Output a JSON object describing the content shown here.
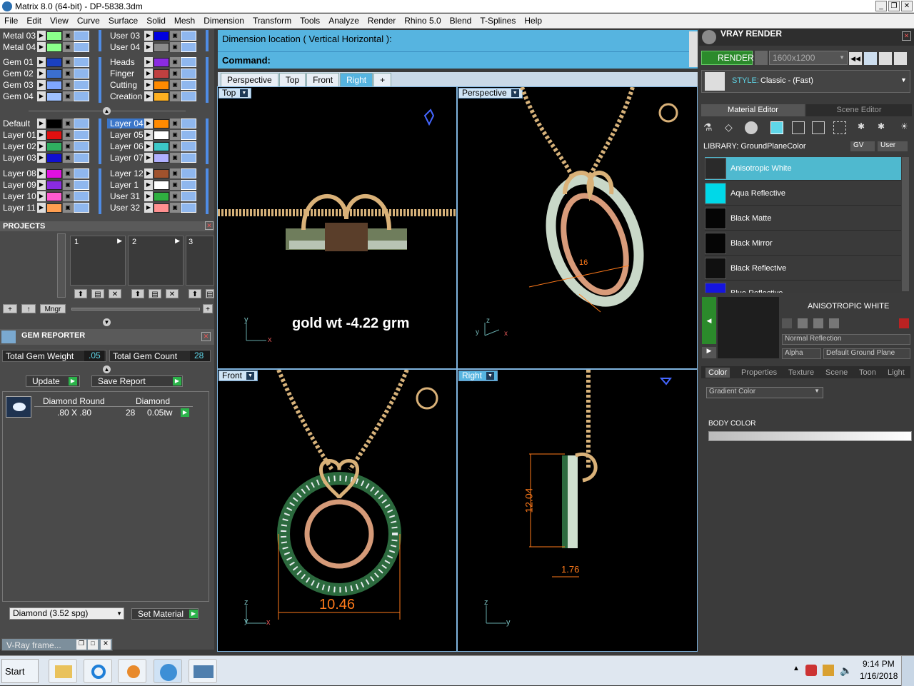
{
  "window": {
    "title": "Matrix 8.0 (64-bit) - DP-5838.3dm"
  },
  "menu": [
    "File",
    "Edit",
    "View",
    "Curve",
    "Surface",
    "Solid",
    "Mesh",
    "Dimension",
    "Transform",
    "Tools",
    "Analyze",
    "Render",
    "Rhino 5.0",
    "Blend",
    "T-Splines",
    "Help"
  ],
  "layers": {
    "col1": [
      {
        "name": "Metal 03",
        "color": "#8bff8b"
      },
      {
        "name": "Metal 04",
        "color": "#8bff8b"
      },
      {
        "name": "Gem 01",
        "color": "#1a40c0"
      },
      {
        "name": "Gem 02",
        "color": "#3b6fd0"
      },
      {
        "name": "Gem 03",
        "color": "#7fa7ff"
      },
      {
        "name": "Gem 04",
        "color": "#9ec0ff"
      },
      {
        "name": "Default",
        "color": "#000000"
      },
      {
        "name": "Layer 01",
        "color": "#e01010"
      },
      {
        "name": "Layer 02",
        "color": "#2fb060"
      },
      {
        "name": "Layer 03",
        "color": "#1010d0"
      },
      {
        "name": "Layer 08",
        "color": "#e010e0"
      },
      {
        "name": "Layer 09",
        "color": "#8a2be2"
      },
      {
        "name": "Layer 10",
        "color": "#ff5ad0"
      },
      {
        "name": "Layer 11",
        "color": "#ff9e50"
      }
    ],
    "col2": [
      {
        "name": "User 03",
        "color": "#0000e0"
      },
      {
        "name": "User 04",
        "color": "#8a8a8a"
      },
      {
        "name": "Heads",
        "color": "#8a2be2"
      },
      {
        "name": "Finger",
        "color": "#c04040"
      },
      {
        "name": "Cutting",
        "color": "#ff8a00"
      },
      {
        "name": "Creation",
        "color": "#ffb020"
      },
      {
        "name": "Layer 04",
        "color": "#ff8a00"
      },
      {
        "name": "Layer 05",
        "color": "#ffffff"
      },
      {
        "name": "Layer 06",
        "color": "#3cc8c8"
      },
      {
        "name": "Layer 07",
        "color": "#b0b0ff"
      },
      {
        "name": "Layer 12",
        "color": "#a0522d"
      },
      {
        "name": "Layer 1",
        "color": "#ffffff"
      },
      {
        "name": "User 31",
        "color": "#2fb040"
      },
      {
        "name": "User 32",
        "color": "#ff9090"
      }
    ]
  },
  "projects": {
    "title": "PROJECTS",
    "slots": [
      "1",
      "2",
      "3"
    ],
    "add": "+",
    "up": "↑",
    "mngr": "Mngr"
  },
  "gem_reporter": {
    "title": "GEM REPORTER",
    "weight_label": "Total Gem Weight",
    "weight_value": ".05",
    "count_label": "Total Gem Count",
    "count_value": "28",
    "update": "Update",
    "save": "Save Report",
    "cols": [
      "Diamond Round",
      "Diamond"
    ],
    "row": {
      "size": ".80 X .80",
      "count": "28",
      "tw": "0.05tw"
    },
    "material": "Diamond    (3.52 spg)",
    "set_material": "Set Material"
  },
  "vray_frame": "V-Ray frame...",
  "command": {
    "prompt1": "Dimension location ( Vertical  Horizontal ):",
    "prompt2": "Command:"
  },
  "view_tabs": [
    "Perspective",
    "Top",
    "Front",
    "Right",
    "+"
  ],
  "viewports": {
    "top": {
      "label": "Top",
      "overlay": "gold wt -4.22 grm"
    },
    "persp": {
      "label": "Perspective",
      "dim": "16"
    },
    "front": {
      "label": "Front",
      "dim": "10.46"
    },
    "right": {
      "label": "Right",
      "dim_v": "12.04",
      "dim_h": "1.76"
    }
  },
  "axes": {
    "x": "x",
    "y": "y",
    "z": "z"
  },
  "vray": {
    "title": "VRAY RENDER",
    "render": "RENDER",
    "resolution": "1600x1200",
    "style_label": "STYLE:",
    "style_value": "Classic - (Fast)",
    "tabs": [
      "Material Editor",
      "Scene Editor"
    ],
    "library": "LIBRARY: GroundPlaneColor",
    "gv": "GV",
    "user": "User",
    "materials": [
      {
        "name": "Anisotropic White",
        "color": "#2a2a2a"
      },
      {
        "name": "Aqua Reflective",
        "color": "#00d8e8"
      },
      {
        "name": "Black Matte",
        "color": "#050505"
      },
      {
        "name": "Black Mirror",
        "color": "#050505"
      },
      {
        "name": "Black Reflective",
        "color": "#101010"
      },
      {
        "name": "Blue Reflective",
        "color": "#1515e0"
      }
    ],
    "selected": "ANISOTROPIC WHITE",
    "reflection": "Normal Reflection",
    "alpha": "Alpha",
    "ground": "Default Ground Plane",
    "prop_tabs": [
      "Color",
      "Properties",
      "Texture",
      "Scene",
      "Toon",
      "Light"
    ],
    "gradient": "Gradient Color",
    "body_color": "BODY COLOR"
  },
  "taskbar": {
    "start": "Start",
    "time": "9:14 PM",
    "date": "1/16/2018"
  }
}
